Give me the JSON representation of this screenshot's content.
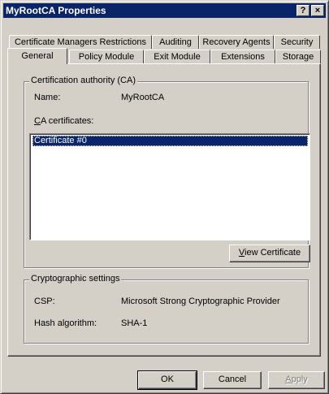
{
  "window": {
    "title": "MyRootCA Properties",
    "help_glyph": "?",
    "close_glyph": "×"
  },
  "tabs": {
    "row_back": [
      {
        "label": "Certificate Managers Restrictions"
      },
      {
        "label": "Auditing"
      },
      {
        "label": "Recovery Agents"
      },
      {
        "label": "Security"
      }
    ],
    "row_front": [
      {
        "label": "General",
        "active": true
      },
      {
        "label": "Policy Module"
      },
      {
        "label": "Exit Module"
      },
      {
        "label": "Extensions"
      },
      {
        "label": "Storage"
      }
    ]
  },
  "ca_group": {
    "legend": "Certification authority (CA)",
    "name_label": "Name:",
    "name_value": "MyRootCA",
    "certs_label_accel": "C",
    "certs_label_rest": "A certificates:",
    "certificates": [
      "Certificate #0"
    ],
    "view_button_accel": "V",
    "view_button_rest": "iew Certificate"
  },
  "crypto_group": {
    "legend": "Cryptographic settings",
    "csp_label": "CSP:",
    "csp_value": "Microsoft Strong Cryptographic Provider",
    "hash_label": "Hash algorithm:",
    "hash_value": "SHA-1"
  },
  "buttons": {
    "ok": "OK",
    "cancel": "Cancel",
    "apply_accel": "A",
    "apply_rest": "pply"
  }
}
